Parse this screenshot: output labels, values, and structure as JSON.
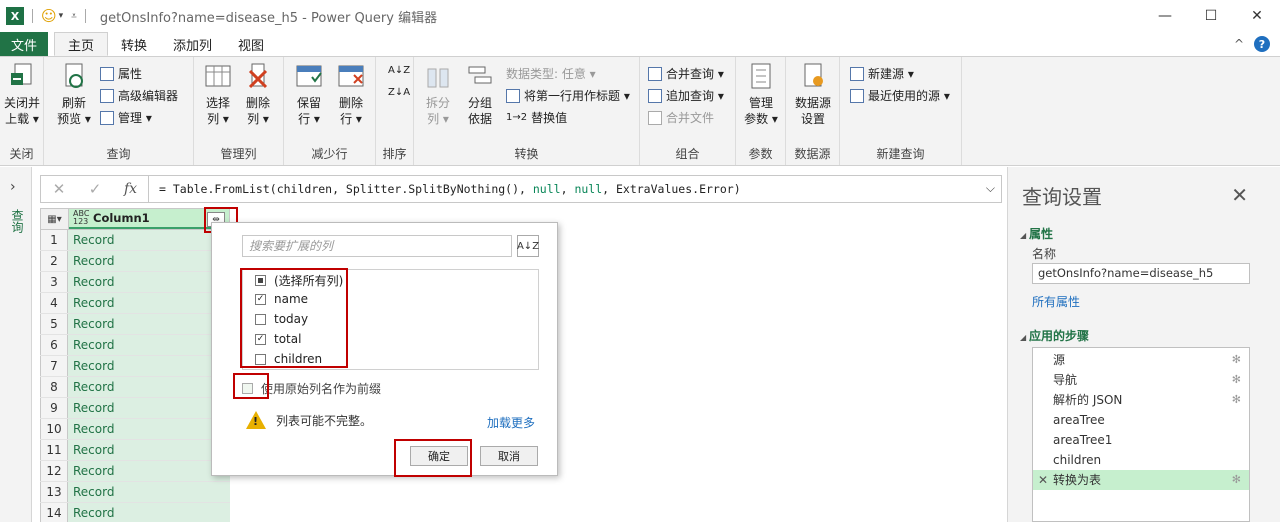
{
  "window": {
    "logo": "X",
    "title": "getOnsInfo?name=disease_h5 - Power Query 编辑器",
    "minimize": "—",
    "maximize": "☐",
    "close": "✕"
  },
  "tabs": {
    "file": "文件",
    "items": [
      "主页",
      "转换",
      "添加列",
      "视图"
    ],
    "collapse": "^",
    "help": "?"
  },
  "ribbon": {
    "close": {
      "btn1": "关闭并",
      "btn2": "上载",
      "label": "关闭"
    },
    "query": {
      "refresh1": "刷新",
      "refresh2": "预览",
      "properties": "属性",
      "advanced_editor": "高级编辑器",
      "manage": "管理",
      "label": "查询"
    },
    "manage_cols": {
      "choose1": "选择",
      "choose2": "列",
      "remove1": "删除",
      "remove2": "列",
      "label": "管理列"
    },
    "reduce_rows": {
      "keep1": "保留",
      "keep2": "行",
      "remove1": "删除",
      "remove2": "行",
      "label": "减少行"
    },
    "sort": {
      "label": "排序"
    },
    "transform": {
      "split1": "拆分",
      "split2": "列",
      "group1": "分组",
      "group2": "依据",
      "data_type": "数据类型: 任意",
      "first_row_header": "将第一行用作标题",
      "replace_values": "替换值",
      "label": "转换"
    },
    "combine": {
      "merge": "合并查询",
      "append": "追加查询",
      "merge_files": "合并文件",
      "label": "组合"
    },
    "params": {
      "manage1": "管理",
      "manage2": "参数",
      "label": "参数"
    },
    "datasource": {
      "btn1": "数据源",
      "btn2": "设置",
      "label": "数据源"
    },
    "new_query": {
      "new_source": "新建源",
      "recent": "最近使用的源",
      "label": "新建查询"
    }
  },
  "left_panel": {
    "label": "查询"
  },
  "formula": {
    "cancel": "✕",
    "commit": "✓",
    "fx": "fx",
    "prefix": "= Table.FromList(children, Splitter.SplitByNothing(), ",
    "null1": "null",
    "sep": ", ",
    "null2": "null",
    "suffix": ", ExtraValues.Error)"
  },
  "grid": {
    "type_label": "ABC 123",
    "column": "Column1",
    "rows": [
      "1",
      "2",
      "3",
      "4",
      "5",
      "6",
      "7",
      "8",
      "9",
      "10",
      "11",
      "12",
      "13",
      "14"
    ],
    "value": "Record"
  },
  "expand_panel": {
    "search_placeholder": "搜索要扩展的列",
    "items": [
      {
        "label": "(选择所有列)",
        "state": "partial"
      },
      {
        "label": "name",
        "state": "checked"
      },
      {
        "label": "today",
        "state": "unchecked"
      },
      {
        "label": "total",
        "state": "checked"
      },
      {
        "label": "children",
        "state": "unchecked"
      }
    ],
    "prefix_option": "使用原始列名作为前缀",
    "warning": "列表可能不完整。",
    "load_more": "加载更多",
    "ok": "确定",
    "cancel": "取消"
  },
  "settings": {
    "title": "查询设置",
    "close": "✕",
    "properties_header": "属性",
    "name_label": "名称",
    "name_value": "getOnsInfo?name=disease_h5",
    "all_props": "所有属性",
    "steps_header": "应用的步骤",
    "steps": [
      "源",
      "导航",
      "解析的 JSON",
      "areaTree",
      "areaTree1",
      "children",
      "转换为表"
    ],
    "active_step": "转换为表"
  },
  "colors": {
    "accent": "#217346",
    "highlight": "#c00000",
    "link": "#1f6fbf"
  }
}
